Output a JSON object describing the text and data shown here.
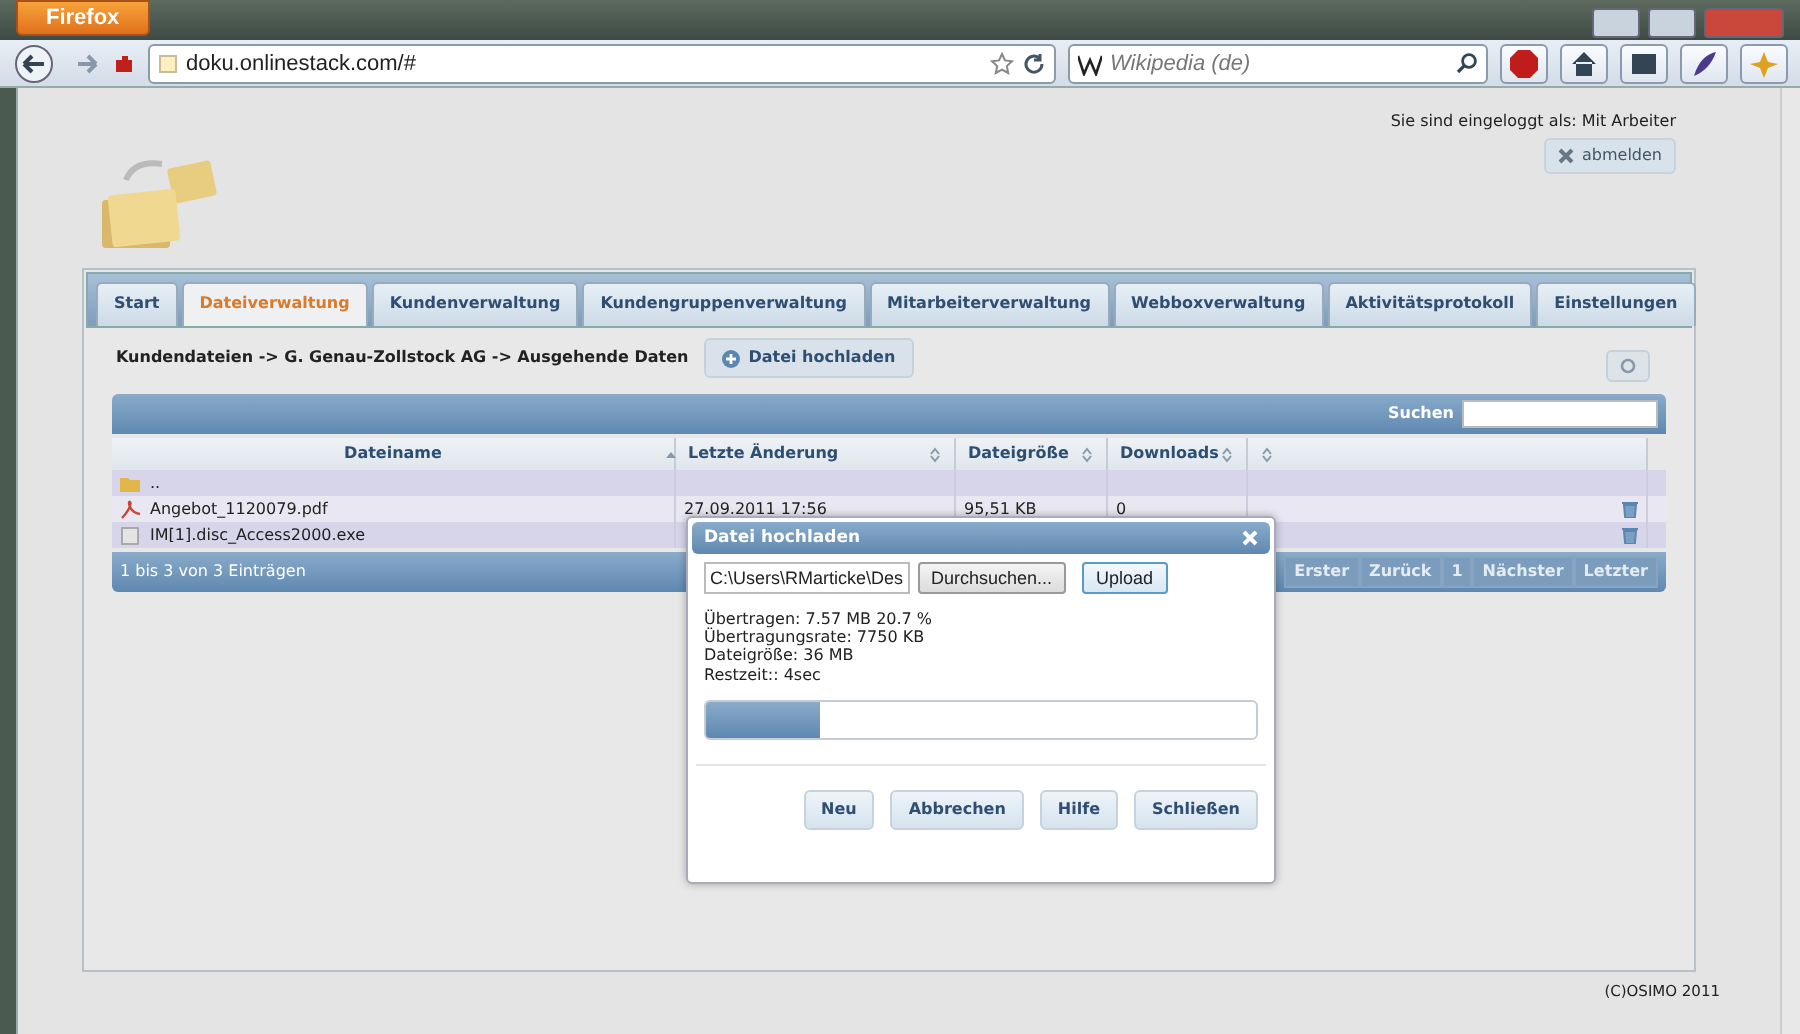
{
  "browser": {
    "menu_button": "Firefox",
    "url": "doku.onlinestack.com/#",
    "search_placeholder": "Wikipedia (de)"
  },
  "user": {
    "login_label": "Sie sind eingeloggt als: Mit Arbeiter",
    "logout": "abmelden"
  },
  "tabs": [
    {
      "label": "Start",
      "selected": false
    },
    {
      "label": "Dateiverwaltung",
      "selected": true
    },
    {
      "label": "Kundenverwaltung",
      "selected": false
    },
    {
      "label": "Kundengruppenverwaltung",
      "selected": false
    },
    {
      "label": "Mitarbeiterverwaltung",
      "selected": false
    },
    {
      "label": "Webboxverwaltung",
      "selected": false
    },
    {
      "label": "Aktivitätsprotokoll",
      "selected": false
    },
    {
      "label": "Einstellungen",
      "selected": false
    }
  ],
  "breadcrumb": "Kundendateien -> G. Genau-Zollstock AG -> Ausgehende Daten",
  "upload_button": "Datei hochladen",
  "table": {
    "search_label": "Suchen",
    "columns": [
      {
        "label": "Dateiname",
        "sorted": true
      },
      {
        "label": "Letzte Änderung",
        "sorted": false
      },
      {
        "label": "Dateigröße",
        "sorted": false
      },
      {
        "label": "Downloads",
        "sorted": false
      },
      {
        "sorted": false
      }
    ],
    "rows": [
      {
        "kind": "folder",
        "name": "..",
        "deletable": false
      },
      {
        "kind": "pdf",
        "name": "Angebot_1120079.pdf",
        "modified": "27.09.2011 17:56",
        "size": "95,51 KB",
        "downloads": "0",
        "deletable": true
      },
      {
        "kind": "file",
        "name": "IM[1].disc_Access2000.exe",
        "deletable": true
      }
    ],
    "info": "1 bis 3 von 3 Einträgen",
    "pager": [
      {
        "label": "Erster",
        "disabled": true
      },
      {
        "label": "Zurück",
        "disabled": true
      },
      {
        "label": "1",
        "disabled": true
      },
      {
        "label": "Nächster",
        "disabled": true
      },
      {
        "label": "Letzter",
        "disabled": true
      }
    ]
  },
  "dialog": {
    "title": "Datei hochladen",
    "file_path": "C:\\Users\\RMarticke\\Des",
    "browse_button": "Durchsuchen...",
    "upload_button": "Upload",
    "stats": [
      "Übertragen: 7.57 MB 20.7 %",
      "Übertragungsrate: 7750 KB",
      "Dateigröße: 36 MB",
      "Restzeit:: 4sec"
    ],
    "progress": {
      "level": 0.207
    },
    "buttons": [
      "Neu",
      "Abbrechen",
      "Hilfe",
      "Schließen"
    ]
  },
  "footer": "(C)OSIMO 2011"
}
